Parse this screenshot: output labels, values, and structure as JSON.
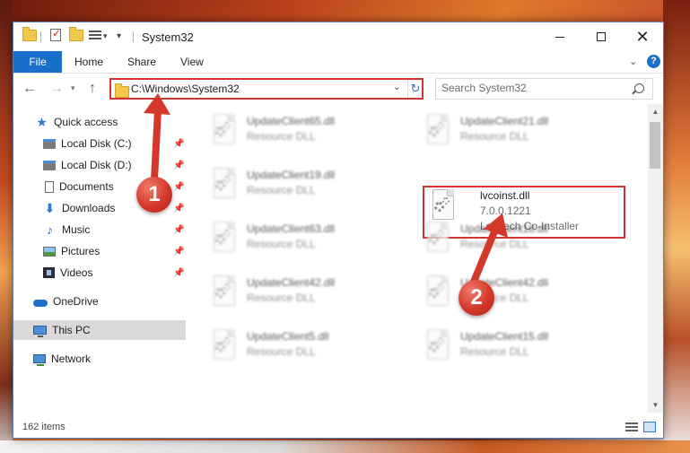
{
  "window": {
    "title": "System32"
  },
  "ribbon": {
    "tabs": [
      "File",
      "Home",
      "Share",
      "View"
    ]
  },
  "address": {
    "path": "C:\\Windows\\System32"
  },
  "search": {
    "placeholder": "Search System32"
  },
  "sidebar": {
    "items": [
      {
        "label": "Quick access",
        "icon": "star-icon"
      },
      {
        "label": "Local Disk (C:)",
        "icon": "disk-icon"
      },
      {
        "label": "Local Disk (D:)",
        "icon": "disk-icon"
      },
      {
        "label": "Documents",
        "icon": "documents-icon"
      },
      {
        "label": "Downloads",
        "icon": "downloads-icon"
      },
      {
        "label": "Music",
        "icon": "music-icon"
      },
      {
        "label": "Pictures",
        "icon": "pictures-icon"
      },
      {
        "label": "Videos",
        "icon": "videos-icon"
      },
      {
        "label": "OneDrive",
        "icon": "onedrive-icon"
      },
      {
        "label": "This PC",
        "icon": "this-pc-icon",
        "selected": true
      },
      {
        "label": "Network",
        "icon": "network-icon"
      }
    ]
  },
  "files": [
    {
      "name": "UpdateClient65.dll",
      "type": "Resource DLL"
    },
    {
      "name": "UpdateClient21.dll",
      "type": "Resource DLL"
    },
    {
      "name": "UpdateClient19.dll",
      "type": "Resource DLL"
    },
    {
      "name": "lvcoinst.dll",
      "version": "7.0.0.1221",
      "type": "Logitech Co-Installer",
      "highlighted": true
    },
    {
      "name": "UpdateClient63.dll",
      "type": "Resource DLL"
    },
    {
      "name": "UpdateClient18.dll",
      "type": "Resource DLL"
    },
    {
      "name": "UpdateClient42.dll",
      "type": "Resource DLL"
    },
    {
      "name": "UpdateClient42.dll",
      "type": "Resource DLL"
    },
    {
      "name": "UpdateClient5.dll",
      "type": "Resource DLL"
    },
    {
      "name": "UpdateClient15.dll",
      "type": "Resource DLL"
    }
  ],
  "status": {
    "item_count": "162 items"
  },
  "callouts": [
    "1",
    "2"
  ],
  "colors": {
    "accent": "#1a6fc9",
    "highlight_border": "#d23434",
    "callout": "#d4382a",
    "selected_nav": "#d9d9d9"
  }
}
